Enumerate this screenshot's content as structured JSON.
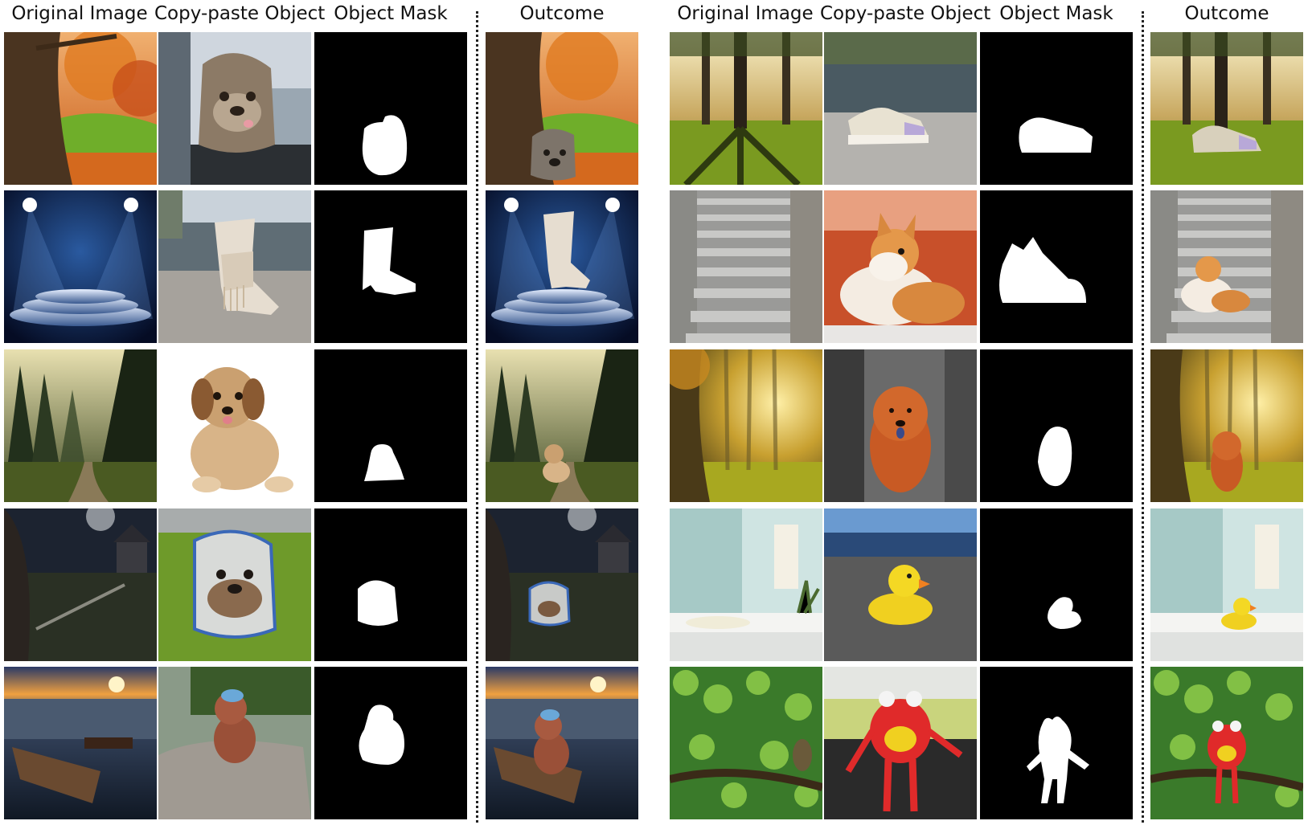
{
  "panels": [
    {
      "headers": {
        "original": "Original Image",
        "copy": "Copy-paste Object",
        "mask": "Object Mask",
        "outcome": "Outcome"
      },
      "rows": [
        {
          "background": "autumn-park",
          "object": "dog-backpack"
        },
        {
          "background": "spotlight-stage",
          "object": "fringe-boot"
        },
        {
          "background": "misty-forest-path",
          "object": "puppy"
        },
        {
          "background": "night-haunted-house",
          "object": "dog-backpack-on-grass"
        },
        {
          "background": "sunset-sea",
          "object": "teddy-bear-on-rock"
        }
      ]
    },
    {
      "headers": {
        "original": "Original Image",
        "copy": "Copy-paste Object",
        "mask": "Object Mask",
        "outcome": "Outcome"
      },
      "rows": [
        {
          "background": "sunlit-tree-park",
          "object": "sneaker"
        },
        {
          "background": "stone-stairs",
          "object": "corgi"
        },
        {
          "background": "sunny-forest",
          "object": "chow-chow"
        },
        {
          "background": "bathroom-counter",
          "object": "rubber-duck"
        },
        {
          "background": "green-leaves-branch",
          "object": "red-plush-toy"
        }
      ]
    }
  ],
  "colors": {
    "mask_background": "#000000",
    "mask_foreground": "#ffffff",
    "divider": "#222222"
  }
}
